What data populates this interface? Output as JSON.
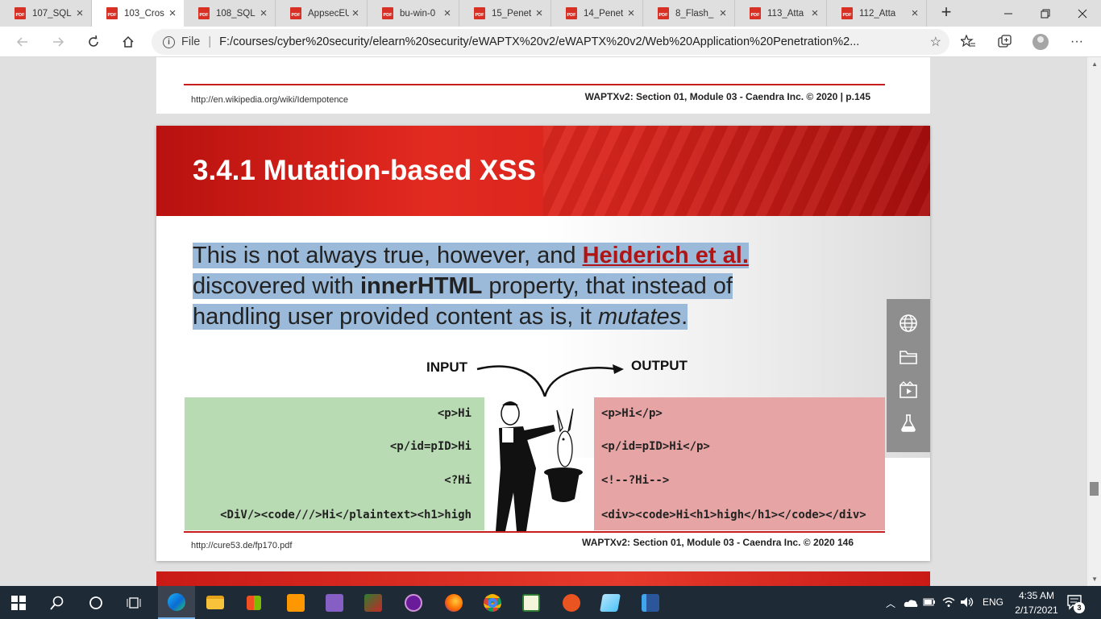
{
  "browser": {
    "tabs": [
      {
        "title": "107_SQL",
        "active": false
      },
      {
        "title": "103_Cros",
        "active": true
      },
      {
        "title": "108_SQL",
        "active": false
      },
      {
        "title": "AppsecEU",
        "active": false
      },
      {
        "title": "bu-win-0",
        "active": false
      },
      {
        "title": "15_Penet",
        "active": false
      },
      {
        "title": "14_Penet",
        "active": false
      },
      {
        "title": "8_Flash_",
        "active": false
      },
      {
        "title": "113_Atta",
        "active": false
      },
      {
        "title": "112_Atta",
        "active": false
      }
    ],
    "pdf_badge": "PDF",
    "new_tab_glyph": "+",
    "address": {
      "file_label": "File",
      "separator": "|",
      "url": "F:/courses/cyber%20security/elearn%20security/eWAPTX%20v2/eWAPTX%20v2/Web%20Application%20Penetration%2..."
    }
  },
  "pdf": {
    "prev_page_footer": {
      "source": "http://en.wikipedia.org/wiki/Idempotence",
      "copyright": "WAPTXv2: Section 01, Module 03 - Caendra Inc. © 2020 |  p.145"
    },
    "slide": {
      "title": "3.4.1 Mutation-based XSS",
      "body": {
        "t1": "This is not always true, however, and ",
        "link": "Heiderich et al.",
        "t2": "discovered with ",
        "strong": "innerHTML",
        "t3": " property, that instead of",
        "t4": "handling user provided content as is, it ",
        "em": "mutates",
        "t5": "."
      },
      "input_label": "INPUT",
      "output_label": "OUTPUT",
      "input_lines": [
        "<p>Hi",
        "<p/id=pID>Hi",
        "<?Hi",
        "<DiV/><code///>Hi</plaintext><h1>high"
      ],
      "output_lines": [
        "<p>Hi</p>",
        "<p/id=pID>Hi</p>",
        "<!--?Hi-->",
        "<div><code>Hi<h1>high</h1></code></div>"
      ],
      "footer": {
        "source": "http://cure53.de/fp170.pdf",
        "copyright": "WAPTXv2: Section 01, Module 03 - Caendra Inc. © 2020 146"
      }
    }
  },
  "taskbar": {
    "language": "ENG",
    "time": "4:35 AM",
    "date": "2/17/2021",
    "notification_count": "3"
  },
  "colors": {
    "banner_red": "#d8251d",
    "input_green": "#b9dbb3",
    "output_red": "#e7a4a4",
    "highlight_blue": "#9bbad9",
    "link_red": "#b01515"
  }
}
